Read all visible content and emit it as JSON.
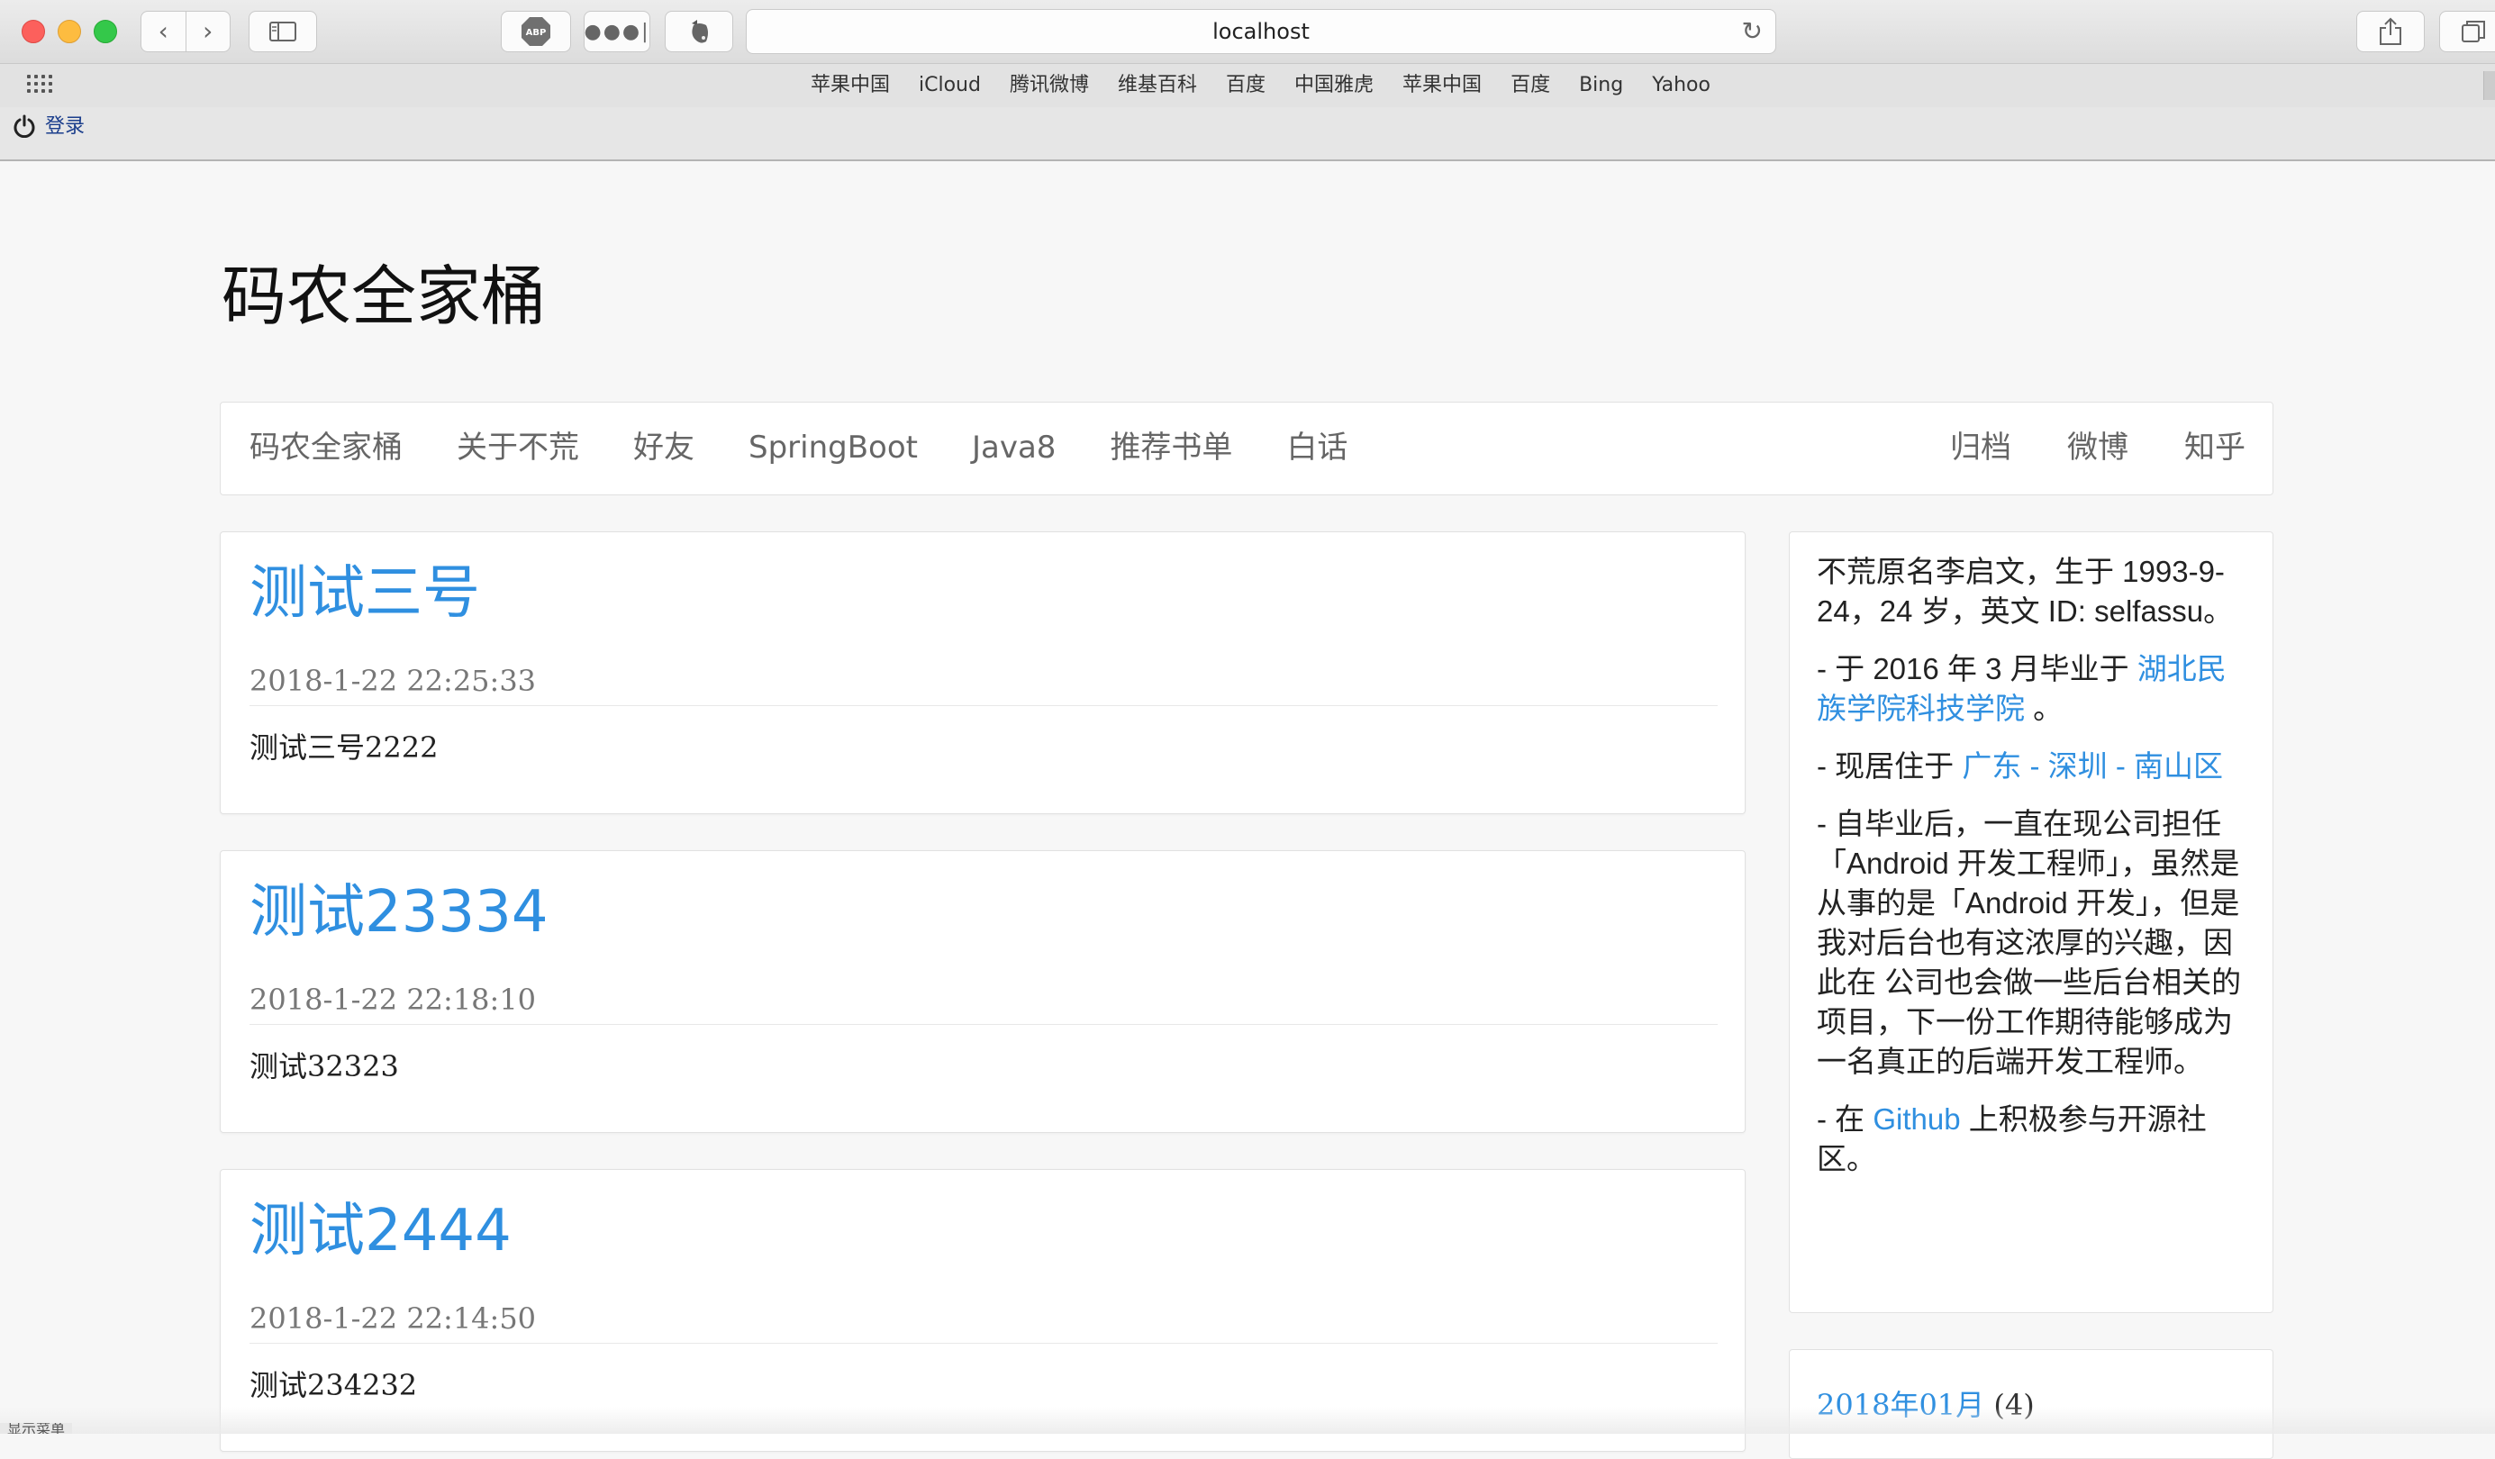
{
  "browser": {
    "url": "localhost",
    "abp_label": "ABP",
    "bookmarks": [
      "苹果中国",
      "iCloud",
      "腾讯微博",
      "维基百科",
      "百度",
      "中国雅虎",
      "苹果中国",
      "百度",
      "Bing",
      "Yahoo"
    ],
    "login_label": "登录"
  },
  "site": {
    "title": "码农全家桶",
    "nav_left": [
      "码农全家桶",
      "关于不荒",
      "好友",
      "SpringBoot",
      "Java8",
      "推荐书单",
      "白话"
    ],
    "nav_right": [
      "归档",
      "微博",
      "知乎"
    ]
  },
  "posts": [
    {
      "title": "测试三号",
      "date": "2018-1-22 22:25:33",
      "body": "测试三号2222"
    },
    {
      "title": "测试23334",
      "date": "2018-1-22 22:18:10",
      "body": "测试32323"
    },
    {
      "title": "测试2444",
      "date": "2018-1-22 22:14:50",
      "body": "测试234232"
    }
  ],
  "about": {
    "intro": "不荒原名李启文，生于 1993-9-24，24 岁，英文 ID: selfassu。",
    "grad_prefix": "- 于 2016 年 3 月毕业于 ",
    "grad_link": "湖北民族学院科技学院",
    "grad_suffix": " 。",
    "live_prefix": "- 现居住于 ",
    "live_link": "广东 - 深圳 - 南山区",
    "work": "- 自毕业后，一直在现公司担任「Android 开发工程师」，虽然是从事的是「Android 开发」，但是我对后台也有这浓厚的兴趣，因此在 公司也会做一些后台相关的项目，下一份工作期待能够成为一名真正的后端开发工程师。",
    "github_prefix": "- 在 ",
    "github_link": "Github",
    "github_suffix": " 上积极参与开源社区。"
  },
  "archive": {
    "month": "2018年01月",
    "count": "(4)"
  },
  "status_bar": "显示菜单"
}
